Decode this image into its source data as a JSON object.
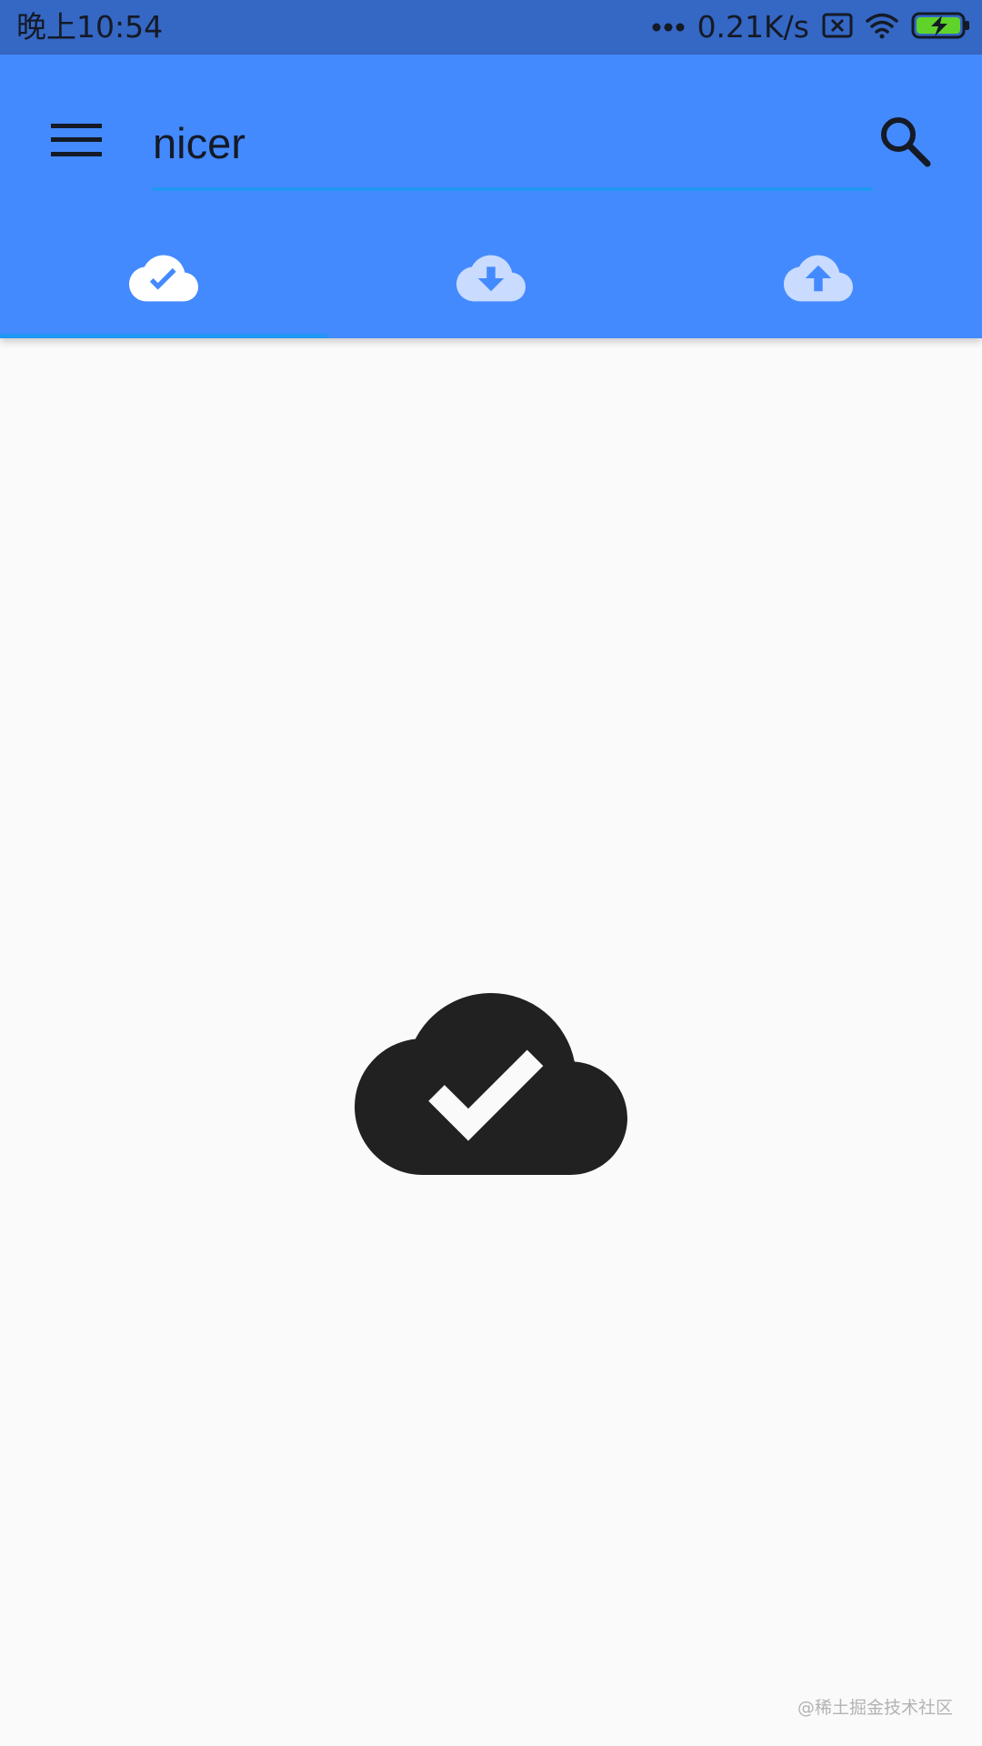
{
  "status_bar": {
    "time": "晚上10:54",
    "speed": "0.21K/s",
    "icons": [
      "more-dots-icon",
      "sim-x-icon",
      "wifi-icon",
      "battery-charging-icon"
    ],
    "colors": {
      "background": "#3567c4"
    }
  },
  "app_bar": {
    "menu_icon": "hamburger-menu-icon",
    "search_value": "nicer",
    "search_icon": "search-icon",
    "colors": {
      "background": "#448aff",
      "accent": "#2196f3"
    }
  },
  "tabs": [
    {
      "icon": "cloud-done-icon",
      "selected": true
    },
    {
      "icon": "cloud-download-icon",
      "selected": false
    },
    {
      "icon": "cloud-upload-icon",
      "selected": false
    }
  ],
  "content": {
    "icon": "cloud-done-icon",
    "watermark": "@稀土掘金技术社区"
  }
}
